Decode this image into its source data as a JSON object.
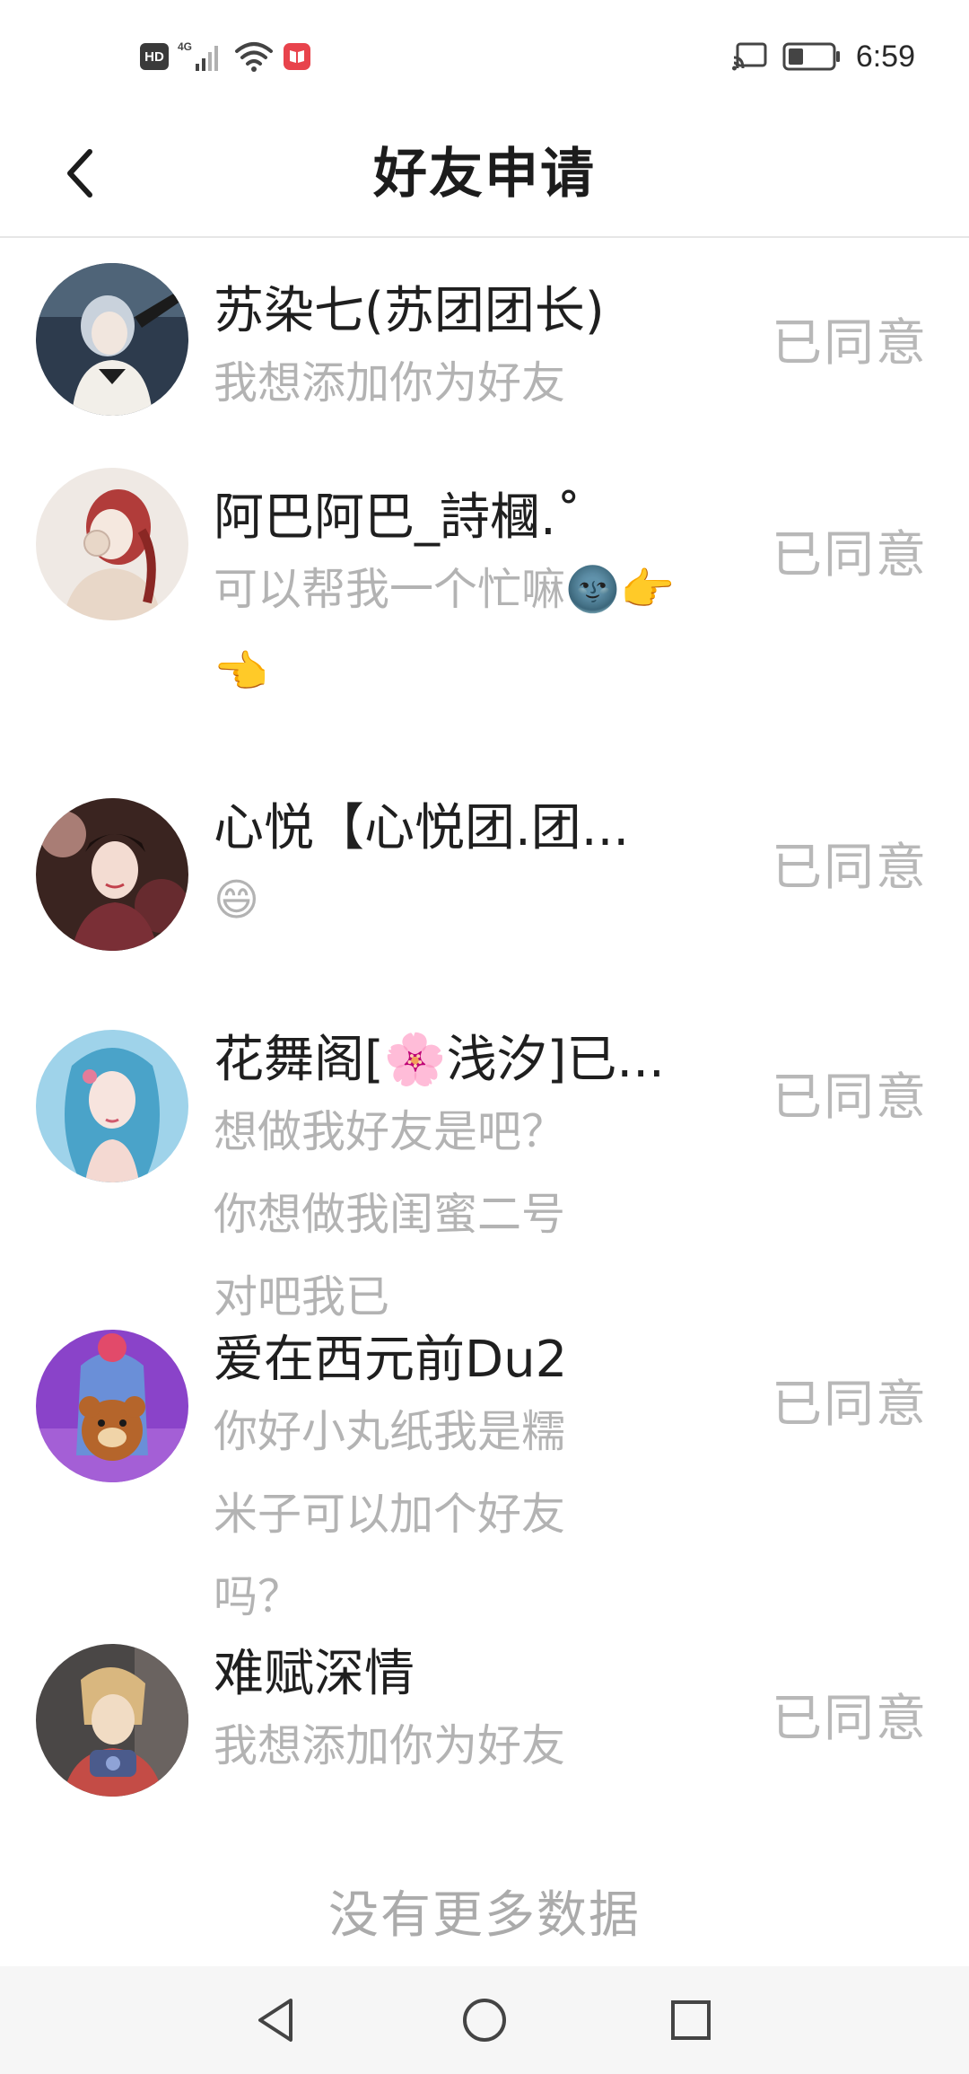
{
  "status_bar": {
    "hd_label": "HD",
    "network_label": "4G",
    "time": "6:59"
  },
  "header": {
    "title": "好友申请",
    "back_icon": "chevron-left-icon"
  },
  "requests": [
    {
      "name": "苏染七(苏团团长)",
      "message": "我想添加你为好友",
      "status": "已同意",
      "avatar_palette": [
        "#2d3b4d",
        "#c9d2dc",
        "#f2efe9"
      ]
    },
    {
      "name": "阿巴阿巴_詩槶.˚",
      "message": "可以帮我一个忙嘛🌚👉👈",
      "status": "已同意",
      "avatar_palette": [
        "#efe9e4",
        "#b13c3a",
        "#e8d7c8"
      ]
    },
    {
      "name": "心悦【心悦团.团...",
      "message": "😄",
      "status": "已同意",
      "avatar_palette": [
        "#3a2420",
        "#d9a49a",
        "#7a2f36"
      ]
    },
    {
      "name": "花舞阁[🌸浅汐]已...",
      "message": "想做我好友是吧？你想做我闺蜜二号对吧我已",
      "status": "已同意",
      "avatar_palette": [
        "#9fd3ea",
        "#4aa3c9",
        "#f4d9d2"
      ]
    },
    {
      "name": "爱在西元前Du2",
      "message": "你好小丸纸我是糯米子可以加个好友吗？",
      "status": "已同意",
      "avatar_palette": [
        "#8a43c9",
        "#6a8fd8",
        "#b5652b"
      ]
    },
    {
      "name": "难赋深情",
      "message": "我想添加你为好友",
      "status": "已同意",
      "avatar_palette": [
        "#4a4746",
        "#d9b77f",
        "#c44c46"
      ]
    }
  ],
  "footer": {
    "no_more_text": "没有更多数据"
  },
  "nav_bar": {
    "back_icon": "triangle-back-icon",
    "home_icon": "circle-home-icon",
    "recent_icon": "square-recent-icon"
  }
}
